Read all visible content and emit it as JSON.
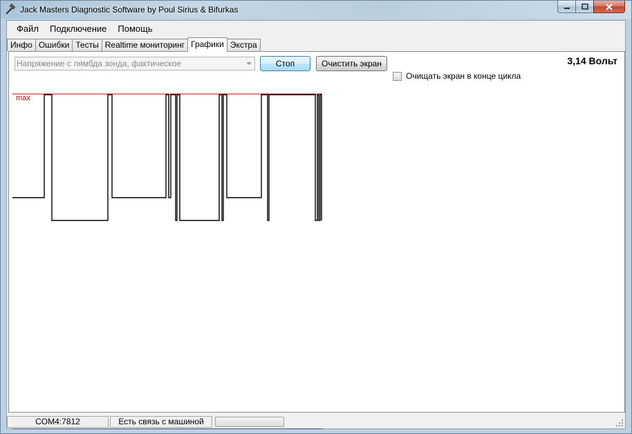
{
  "window": {
    "title": "Jack Masters Diagnostic Software by Poul Sirius & Bifurkas"
  },
  "menu": [
    {
      "label": "Файл"
    },
    {
      "label": "Подключение"
    },
    {
      "label": "Помощь"
    }
  ],
  "tabs": [
    {
      "label": "Инфо"
    },
    {
      "label": "Ошибки"
    },
    {
      "label": "Тесты"
    },
    {
      "label": "Realtime мониторинг"
    },
    {
      "label": "Графики",
      "active": true
    },
    {
      "label": "Экстра"
    }
  ],
  "graphs_panel": {
    "parameter_select": {
      "value": "Напряжение с лямбда зонда, фактическое"
    },
    "stop_button": "Стоп",
    "clear_button": "Очистить экран",
    "voltage_readout": "3,14 Вольт",
    "clear_on_cycle_checkbox": {
      "label": "Очищать экран в конце цикла",
      "checked": false
    },
    "max_label": "max",
    "colors": {
      "signal": "#000000",
      "max_line": "#cc0000",
      "baseline": "#1a1a6e"
    }
  },
  "statusbar": {
    "port": "COM4:7812",
    "connection": "Есть связь с машиной"
  },
  "colors": {
    "button_hover": "#bee6fd",
    "panel_bg": "#ffffff",
    "chrome_bg": "#f0f0f0"
  },
  "icons": [
    "app-hammer-icon",
    "minimize-icon",
    "maximize-icon",
    "close-icon",
    "dropdown-arrow-icon",
    "resize-grip-icon"
  ]
}
